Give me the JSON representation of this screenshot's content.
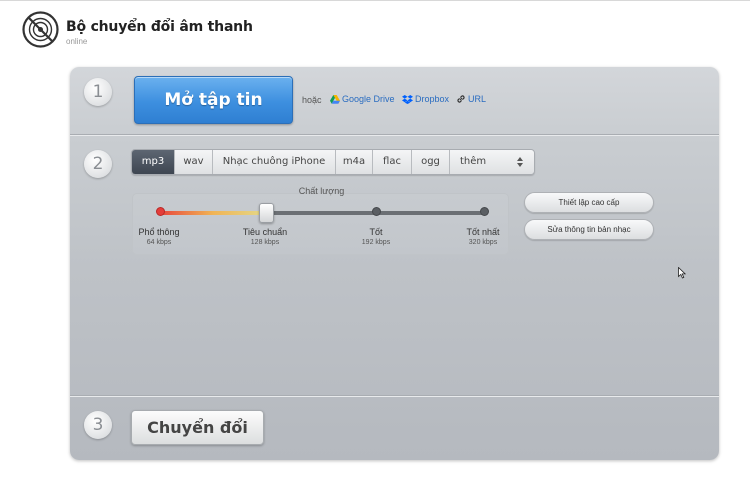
{
  "app": {
    "title": "Bộ chuyển đổi âm thanh",
    "subtitle": "online"
  },
  "step1": {
    "number": "1",
    "open_button": "Mở tập tin",
    "or_text": "hoặc",
    "sources": [
      {
        "label": "Google Drive",
        "icon": "google-drive-icon"
      },
      {
        "label": "Dropbox",
        "icon": "dropbox-icon"
      },
      {
        "label": "URL",
        "icon": "link-icon"
      }
    ]
  },
  "step2": {
    "number": "2",
    "formats": [
      {
        "label": "mp3",
        "selected": true
      },
      {
        "label": "wav",
        "selected": false
      },
      {
        "label": "Nhạc chuông iPhone",
        "selected": false
      },
      {
        "label": "m4a",
        "selected": false
      },
      {
        "label": "flac",
        "selected": false
      },
      {
        "label": "ogg",
        "selected": false
      },
      {
        "label": "thêm",
        "selected": false
      }
    ],
    "quality": {
      "label": "Chất lượng",
      "selected_index": 1,
      "levels": [
        {
          "name": "Phổ thông",
          "rate": "64 kbps"
        },
        {
          "name": "Tiêu chuẩn",
          "rate": "128 kbps"
        },
        {
          "name": "Tốt",
          "rate": "192 kbps"
        },
        {
          "name": "Tốt nhất",
          "rate": "320 kbps"
        }
      ]
    },
    "advanced_button": "Thiết lập cao cấp",
    "metadata_button": "Sửa thông tin bản nhạc"
  },
  "step3": {
    "number": "3",
    "convert_button": "Chuyển đổi"
  },
  "colors": {
    "primary_button": "#3d8fdf",
    "active_tab": "#4a525d",
    "link": "#2a6cc0"
  }
}
